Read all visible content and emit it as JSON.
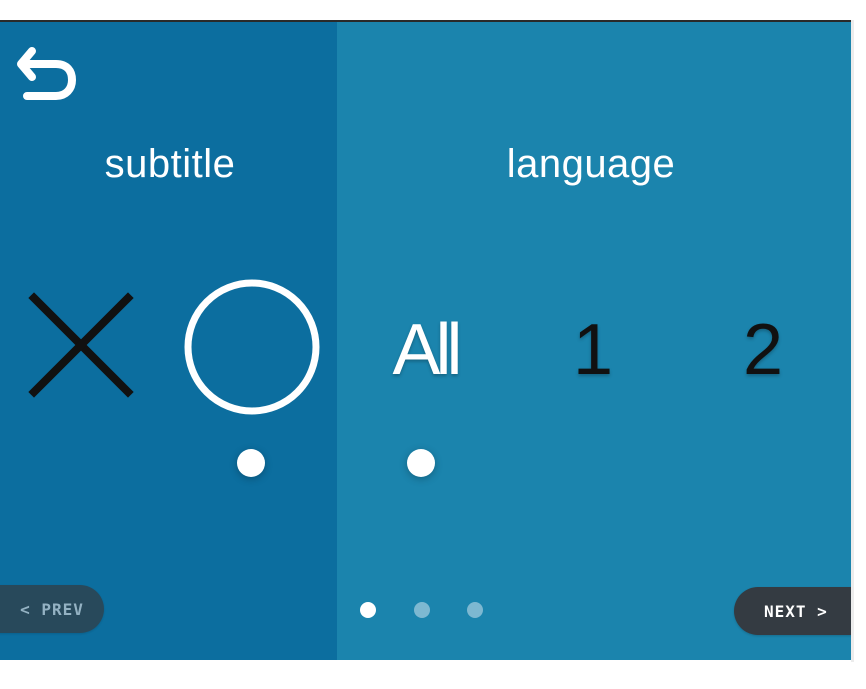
{
  "screen": {
    "left_panel_color": "#0c6e9f",
    "right_panel_color": "#1b84ad"
  },
  "back_button": {
    "icon": "return-arrow-icon"
  },
  "subtitle": {
    "title": "subtitle",
    "options": [
      {
        "icon": "close-x-icon",
        "selected": false
      },
      {
        "icon": "circle-icon",
        "selected": true
      }
    ]
  },
  "language": {
    "title": "language",
    "options": [
      "All",
      "1",
      "2"
    ],
    "selected": "All"
  },
  "navigation": {
    "prev_label": "< PREV",
    "next_label": "NEXT >",
    "page_count": 3,
    "current_page": 1
  }
}
